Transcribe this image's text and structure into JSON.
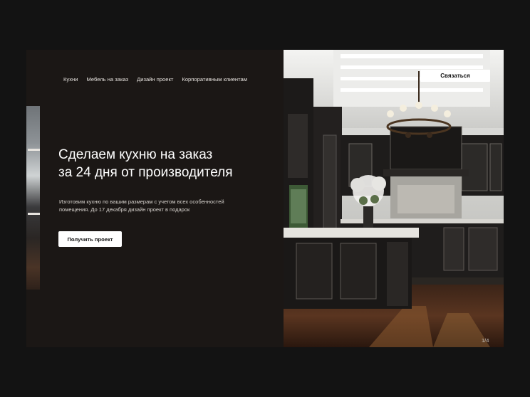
{
  "nav": {
    "items": [
      {
        "label": "Кухни"
      },
      {
        "label": "Мебель на заказ"
      },
      {
        "label": "Дизайн проект"
      },
      {
        "label": "Корпоративным клиентам"
      }
    ]
  },
  "header": {
    "contact_label": "Связаться"
  },
  "hero": {
    "title_line1": "Сделаем кухню на заказ",
    "title_line2": "за 24 дня от производителя",
    "subtitle_line1": "Изготовим кухню по вашим размерам с учетом всех особенностей",
    "subtitle_line2": "помещения.  До 17 декабря дизайн проект в подарок",
    "cta_label": "Получить проект"
  },
  "slider": {
    "counter": "1/4",
    "current": 1,
    "total": 4
  },
  "colors": {
    "page_bg": "#131313",
    "hero_bg": "#1b1715",
    "text_primary": "#ffffff",
    "button_bg": "#ffffff"
  }
}
